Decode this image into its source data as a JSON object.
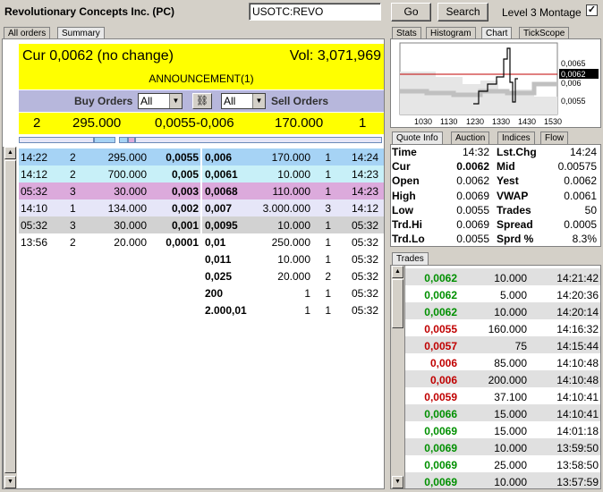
{
  "header": {
    "company": "Revolutionary Concepts Inc. (PC)",
    "symbol_value": "USOTC:REVO",
    "go_label": "Go",
    "search_label": "Search",
    "level3_label": "Level 3 Montage",
    "level3_checked": "✓"
  },
  "left_tabs": [
    "All orders",
    "Summary"
  ],
  "summary": {
    "cur": "Cur 0,0062 (no change)",
    "vol": "Vol: 3,071,969",
    "announcement": "ANNOUNCEMENT(1)",
    "buy_orders_label": "Buy Orders",
    "sell_orders_label": "Sell Orders",
    "buy_filter": "All",
    "sell_filter": "All",
    "buy_count": "2",
    "buy_volume": "295.000",
    "buy_price": "0,0055",
    "sell_price": "-0,006",
    "sell_volume": "170.000",
    "sell_count": "1"
  },
  "buy_orders": [
    {
      "time": "14:22",
      "n": "2",
      "size": "295.000",
      "price": "0,0055"
    },
    {
      "time": "14:12",
      "n": "2",
      "size": "700.000",
      "price": "0,005"
    },
    {
      "time": "05:32",
      "n": "3",
      "size": "30.000",
      "price": "0,003"
    },
    {
      "time": "14:10",
      "n": "1",
      "size": "134.000",
      "price": "0,002"
    },
    {
      "time": "05:32",
      "n": "3",
      "size": "30.000",
      "price": "0,001"
    },
    {
      "time": "13:56",
      "n": "2",
      "size": "20.000",
      "price": "0,0001"
    }
  ],
  "sell_orders": [
    {
      "price": "0,006",
      "size": "170.000",
      "n": "1",
      "time": "14:24"
    },
    {
      "price": "0,0061",
      "size": "10.000",
      "n": "1",
      "time": "14:23"
    },
    {
      "price": "0,0068",
      "size": "110.000",
      "n": "1",
      "time": "14:23"
    },
    {
      "price": "0,007",
      "size": "3.000.000",
      "n": "3",
      "time": "14:12"
    },
    {
      "price": "0,0095",
      "size": "10.000",
      "n": "1",
      "time": "05:32"
    },
    {
      "price": "0,01",
      "size": "250.000",
      "n": "1",
      "time": "05:32"
    },
    {
      "price": "0,011",
      "size": "10.000",
      "n": "1",
      "time": "05:32"
    },
    {
      "price": "0,025",
      "size": "20.000",
      "n": "2",
      "time": "05:32"
    },
    {
      "price": "200",
      "size": "1",
      "n": "1",
      "time": "05:32"
    },
    {
      "price": "2.000,01",
      "size": "1",
      "n": "1",
      "time": "05:32"
    }
  ],
  "chart_tabs": [
    "Stats",
    "Histogram",
    "Chart",
    "TickScope"
  ],
  "chart": {
    "y_labels": [
      "0,0065",
      "0,0062",
      "0,006",
      "0,0055"
    ],
    "x_labels": [
      "1030",
      "1130",
      "1230",
      "1330",
      "1430",
      "1530"
    ]
  },
  "quote_tabs": [
    "Quote Info",
    "Auction",
    "Indices",
    "Flow"
  ],
  "quote": [
    {
      "l1": "Time",
      "v1": "14:32",
      "l2": "Lst.Chg",
      "v2": "14:24"
    },
    {
      "l1": "Cur",
      "v1": "0.0062",
      "l2": "Mid",
      "v2": "0.00575"
    },
    {
      "l1": "Open",
      "v1": "0.0062",
      "l2": "Yest",
      "v2": "0.0062"
    },
    {
      "l1": "High",
      "v1": "0.0069",
      "l2": "VWAP",
      "v2": "0.0061"
    },
    {
      "l1": "Low",
      "v1": "0.0055",
      "l2": "Trades",
      "v2": "50"
    },
    {
      "l1": "Trd.Hi",
      "v1": "0.0069",
      "l2": "Spread",
      "v2": "0.0005"
    },
    {
      "l1": "Trd.Lo",
      "v1": "0.0055",
      "l2": "Sprd %",
      "v2": "8.3%"
    }
  ],
  "trades_tab": "Trades",
  "trades": [
    {
      "price": "0,0062",
      "size": "10.000",
      "time": "14:21:42",
      "dir": "up"
    },
    {
      "price": "0,0062",
      "size": "5.000",
      "time": "14:20:36",
      "dir": "up"
    },
    {
      "price": "0,0062",
      "size": "10.000",
      "time": "14:20:14",
      "dir": "up"
    },
    {
      "price": "0,0055",
      "size": "160.000",
      "time": "14:16:32",
      "dir": "down"
    },
    {
      "price": "0,0057",
      "size": "75",
      "time": "14:15:44",
      "dir": "down"
    },
    {
      "price": "0,006",
      "size": "85.000",
      "time": "14:10:48",
      "dir": "down"
    },
    {
      "price": "0,006",
      "size": "200.000",
      "time": "14:10:48",
      "dir": "down"
    },
    {
      "price": "0,0059",
      "size": "37.100",
      "time": "14:10:41",
      "dir": "down"
    },
    {
      "price": "0,0066",
      "size": "15.000",
      "time": "14:10:41",
      "dir": "up"
    },
    {
      "price": "0,0069",
      "size": "15.000",
      "time": "14:01:18",
      "dir": "up"
    },
    {
      "price": "0,0069",
      "size": "10.000",
      "time": "13:59:50",
      "dir": "up"
    },
    {
      "price": "0,0069",
      "size": "25.000",
      "time": "13:58:50",
      "dir": "up"
    },
    {
      "price": "0,0069",
      "size": "10.000",
      "time": "13:57:59",
      "dir": "up"
    }
  ],
  "colors": {
    "buy_rows": [
      "#a6d3f5",
      "#c8f0f8",
      "#dcaadc",
      "#e6e6f8",
      "#d2d2d2",
      "#ffffff"
    ],
    "sell_rows": [
      "#a6d3f5",
      "#c8f0f8",
      "#dcaadc",
      "#e6e6f8",
      "#d2d2d2",
      "#ffffff",
      "#ffffff",
      "#ffffff",
      "#ffffff",
      "#ffffff"
    ]
  }
}
